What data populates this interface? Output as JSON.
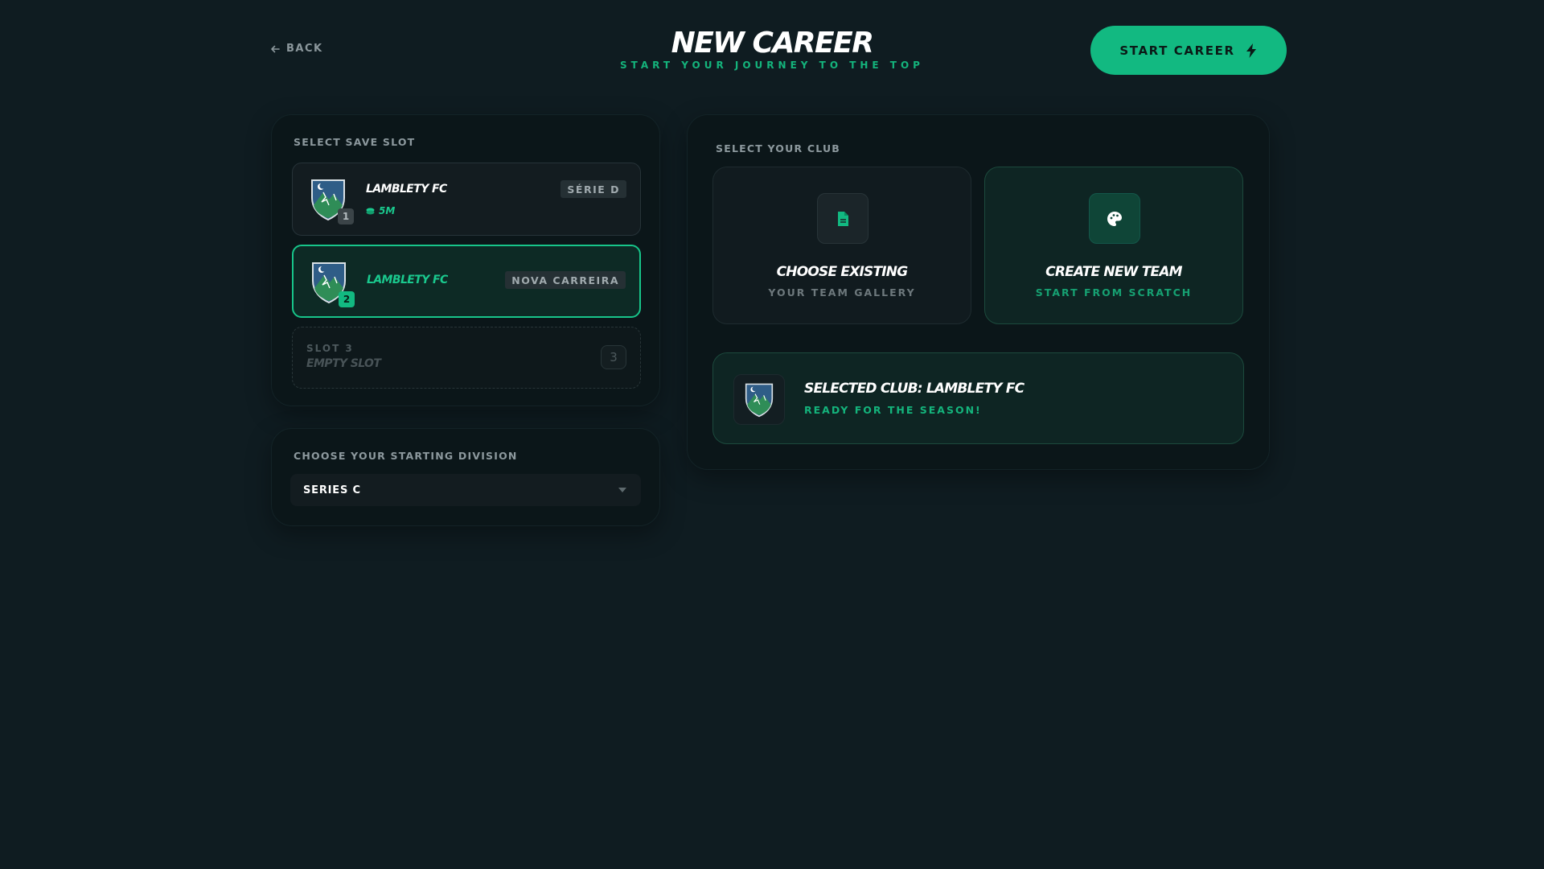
{
  "header": {
    "back_label": "BACK",
    "title": "NEW CAREER",
    "subtitle": "START YOUR JOURNEY TO THE TOP",
    "start_label": "START CAREER"
  },
  "save_slots": {
    "label": "SELECT SAVE SLOT",
    "slots": [
      {
        "number": "1",
        "club": "LAMBLETY FC",
        "funds": "5M",
        "tag": "SÉRIE D",
        "active": false
      },
      {
        "number": "2",
        "club": "LAMBLETY FC",
        "tag": "NOVA CARREIRA",
        "active": true
      },
      {
        "slot_label": "SLOT 3",
        "empty_label": "EMPTY SLOT",
        "number": "3"
      }
    ]
  },
  "division": {
    "label": "CHOOSE YOUR STARTING DIVISION",
    "selected": "SERIES C"
  },
  "club": {
    "label": "SELECT YOUR CLUB",
    "options": [
      {
        "title": "CHOOSE EXISTING",
        "subtitle": "YOUR TEAM GALLERY",
        "icon": "document-icon"
      },
      {
        "title": "CREATE NEW TEAM",
        "subtitle": "START FROM SCRATCH",
        "icon": "palette-icon"
      }
    ],
    "selected_title": "SELECTED CLUB: LAMBLETY FC",
    "selected_subtitle": "READY FOR THE SEASON!"
  },
  "colors": {
    "background": "#0f1c21",
    "accent": "#12b981",
    "panel": "#0b1619"
  }
}
